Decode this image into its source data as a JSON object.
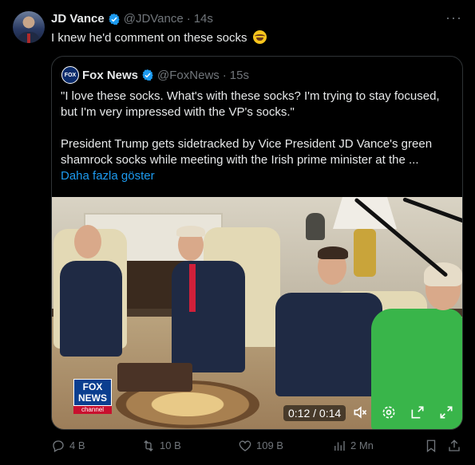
{
  "post": {
    "author_name": "JD Vance",
    "author_handle": "@JDVance",
    "separator": "·",
    "time": "14s",
    "text": "I knew he'd comment on these socks",
    "more_icon": "ellipsis-icon"
  },
  "quote": {
    "author_name": "Fox News",
    "author_handle": "@FoxNews",
    "separator": "·",
    "time": "15s",
    "logo_text_top": "FOX",
    "logo_text_bottom": "NEWS",
    "paragraph_1": "\"I love these socks. What's with these socks? I'm trying to stay focused, but I'm very impressed with the VP's socks.\"",
    "paragraph_2": "President Trump gets sidetracked by Vice President JD Vance's green shamrock socks while meeting with the Irish prime minister at the ...",
    "show_more": "Daha fazla göster"
  },
  "video": {
    "bug_line_1": "FOX",
    "bug_line_2": "NEWS",
    "bug_line_3": "channel",
    "time_display": "0:12 / 0:14",
    "controls": [
      "mute-icon",
      "settings-icon",
      "minimize-icon",
      "fullscreen-icon"
    ]
  },
  "actions": {
    "replies": "4 B",
    "reposts": "10 B",
    "likes": "109 B",
    "views": "2 Mn"
  },
  "colors": {
    "background": "#000000",
    "text": "#e7e9ea",
    "muted": "#71767b",
    "link": "#1d9bf0",
    "border": "#2f3336",
    "verified_blue": "#1d9bf0"
  }
}
